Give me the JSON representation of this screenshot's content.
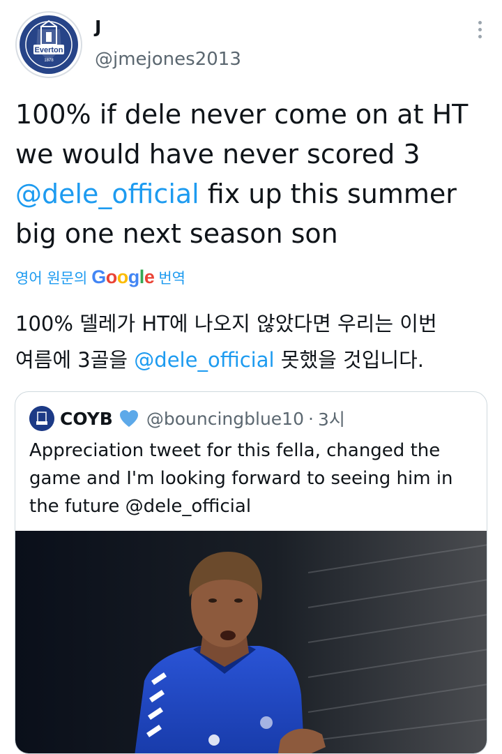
{
  "author": {
    "display_name": "J",
    "handle": "@jmejones2013",
    "avatar_icon": "everton-crest-icon",
    "avatar_text": "Everton",
    "avatar_year": "1878"
  },
  "menu": {
    "icon": "more-vertical-icon"
  },
  "tweet": {
    "line1": "100% if dele never come on at HT",
    "line2": "we would have never scored 3",
    "mention": "@dele_official",
    "line3_rest": " fix up this summer",
    "line4": "big one next season son"
  },
  "translation": {
    "label_prefix": "영어 원문의",
    "google_letters": [
      "G",
      "o",
      "o",
      "g",
      "l",
      "e"
    ],
    "google_colors": [
      "#4285F4",
      "#EA4335",
      "#FBBC05",
      "#4285F4",
      "#34A853",
      "#EA4335"
    ],
    "label_suffix": "번역",
    "line1": "100% 델레가 HT에 나오지 않았다면 우리는 이번",
    "line2_prefix": "여름에 3골을 ",
    "mention": "@dele_official",
    "line2_suffix": " 못했을 것입니다."
  },
  "quoted_tweet": {
    "display_name": "COYB",
    "verified_icon": "blue-heart-icon",
    "handle": "@bouncingblue10",
    "separator": "·",
    "time": "3시",
    "text": "Appreciation tweet for this fella, changed the game and I'm looking forward to seeing him in the future @dele_official",
    "media_icon": "football-player-photo-icon"
  },
  "colors": {
    "link": "#1d9bf0",
    "text": "#0f1419",
    "secondary": "#5b6770",
    "everton_blue": "#274488",
    "border": "#cfd9de"
  }
}
